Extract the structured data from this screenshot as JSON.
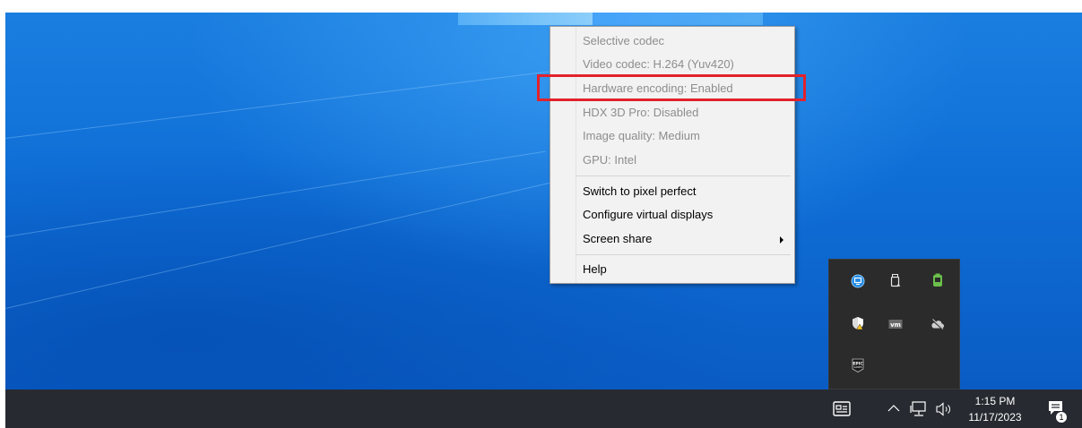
{
  "context_menu": {
    "info_items": [
      {
        "label": "Selective codec",
        "enabled": false
      },
      {
        "label": "Video codec: H.264 (Yuv420)",
        "enabled": false
      },
      {
        "label": "Hardware encoding: Enabled",
        "enabled": false,
        "highlighted": true
      },
      {
        "label": "HDX 3D Pro: Disabled",
        "enabled": false
      },
      {
        "label": "Image quality: Medium",
        "enabled": false
      },
      {
        "label": "GPU: Intel",
        "enabled": false
      }
    ],
    "action_items": [
      {
        "label": "Switch to pixel perfect"
      },
      {
        "label": "Configure virtual displays"
      },
      {
        "label": "Screen share",
        "submenu": true
      }
    ],
    "help_item": {
      "label": "Help"
    },
    "highlight_color": "#e3222b"
  },
  "tray_overflow": {
    "icons": [
      "citrix-workspace-icon",
      "usb-drive-icon",
      "battery-green-icon",
      "security-shield-warning-icon",
      "vmware-icon",
      "onedrive-offline-icon",
      "epic-games-icon"
    ]
  },
  "taskbar": {
    "clock": {
      "time": "1:15 PM",
      "date": "11/17/2023"
    },
    "notification_count": "1",
    "icons": [
      "news-widget-icon",
      "chevron-up-icon",
      "network-icon",
      "volume-icon",
      "action-center-icon"
    ],
    "background": "#272a30"
  },
  "desktop": {
    "background": "#0f6ed6"
  }
}
